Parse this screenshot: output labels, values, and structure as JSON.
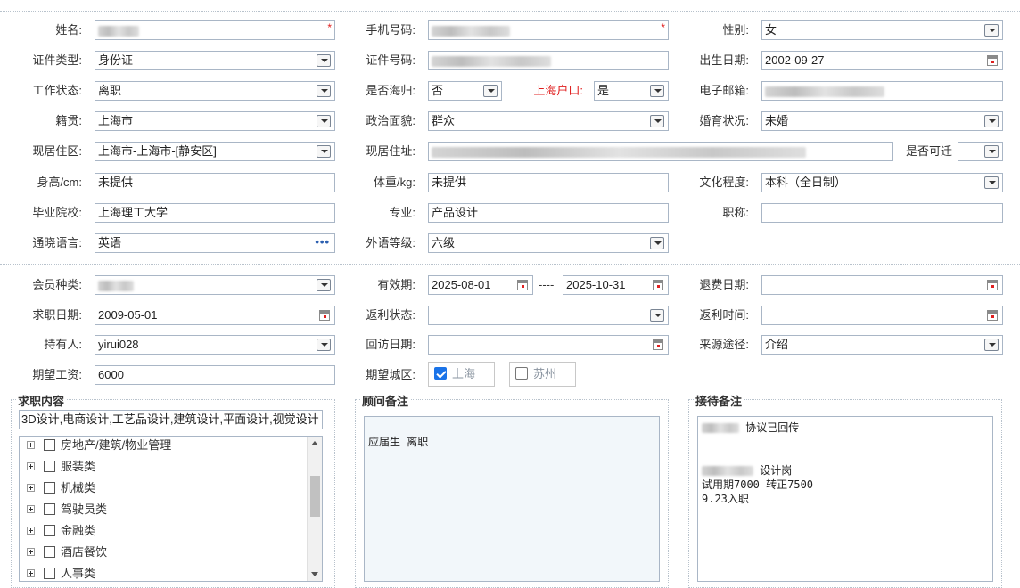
{
  "basic": {
    "name_label": "姓名:",
    "phone_label": "手机号码:",
    "gender_label": "性别:",
    "gender_value": "女",
    "id_type_label": "证件类型:",
    "id_type_value": "身份证",
    "id_no_label": "证件号码:",
    "birth_label": "出生日期:",
    "birth_value": "2002-09-27",
    "work_status_label": "工作状态:",
    "work_status_value": "离职",
    "returnee_label": "是否海归:",
    "returnee_value": "否",
    "sh_hukou_label": "上海户口:",
    "sh_hukou_value": "是",
    "email_label": "电子邮箱:",
    "native_label": "籍贯:",
    "native_value": "上海市",
    "political_label": "政治面貌:",
    "political_value": "群众",
    "marital_label": "婚育状况:",
    "marital_value": "未婚",
    "residence_label": "现居住区:",
    "residence_value": "上海市-上海市-[静安区]",
    "address_label": "现居住址:",
    "relocate_label": "是否可迁",
    "height_label": "身高/cm:",
    "height_value": "未提供",
    "weight_label": "体重/kg:",
    "weight_value": "未提供",
    "education_label": "文化程度:",
    "education_value": "本科（全日制）",
    "school_label": "毕业院校:",
    "school_value": "上海理工大学",
    "major_label": "专业:",
    "major_value": "产品设计",
    "title_label": "职称:",
    "language_label": "通晓语言:",
    "language_value": "英语",
    "foreign_level_label": "外语等级:",
    "foreign_level_value": "六级"
  },
  "member": {
    "type_label": "会员种类:",
    "valid_label": "有效期:",
    "valid_from": "2025-08-01",
    "valid_sep": "----",
    "valid_to": "2025-10-31",
    "refund_date_label": "退费日期:",
    "job_date_label": "求职日期:",
    "job_date_value": "2009-05-01",
    "rebate_status_label": "返利状态:",
    "rebate_time_label": "返利时间:",
    "holder_label": "持有人:",
    "holder_value": "yirui028",
    "visit_date_label": "回访日期:",
    "source_label": "来源途径:",
    "source_value": "介绍",
    "salary_label": "期望工资:",
    "salary_value": "6000",
    "city_label": "期望城区:",
    "city_options": [
      {
        "label": "上海",
        "checked": true
      },
      {
        "label": "苏州",
        "checked": false
      }
    ]
  },
  "job_content": {
    "title": "求职内容",
    "summary": "3D设计,电商设计,工艺品设计,建筑设计,平面设计,视觉设计",
    "tree": [
      "房地产/建筑/物业管理",
      "服装类",
      "机械类",
      "驾驶员类",
      "金融类",
      "酒店餐饮",
      "人事类"
    ]
  },
  "advisor_notes": {
    "title": "顾问备注",
    "text": "\n应届生 离职"
  },
  "reception_notes": {
    "title": "接待备注",
    "line1": " 协议已回传",
    "line2": " 设计岗",
    "line3": "试用期7000 转正7500\n9.23入职"
  }
}
